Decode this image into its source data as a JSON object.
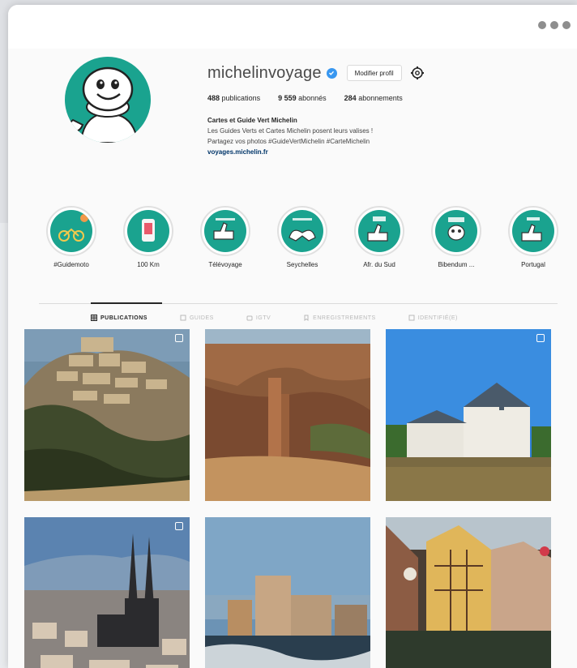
{
  "window": {
    "menu_icon": "ellipsis-icon"
  },
  "profile": {
    "username": "michelinvoyage",
    "edit_label": "Modifier profil",
    "stats": {
      "publications_count": "488",
      "publications_label": "publications",
      "followers_count": "9 559",
      "followers_label": "abonnés",
      "following_count": "284",
      "following_label": "abonnements"
    },
    "bio": {
      "name": "Cartes et Guide Vert Michelin",
      "line1": "Les Guides Verts et Cartes Michelin posent leurs valises !",
      "line2": "Partagez vos photos #GuideVertMichelin #CarteMichelin",
      "link": "voyages.michelin.fr"
    }
  },
  "highlights": [
    {
      "label": "#Guidemoto"
    },
    {
      "label": "100 Km"
    },
    {
      "label": "Télévoyage"
    },
    {
      "label": "Seychelles"
    },
    {
      "label": "Afr. du Sud"
    },
    {
      "label": "Bibendum ..."
    },
    {
      "label": "Portugal"
    }
  ],
  "tabs": [
    {
      "label": "PUBLICATIONS",
      "active": true
    },
    {
      "label": "GUIDES",
      "active": false
    },
    {
      "label": "IGTV",
      "active": false
    },
    {
      "label": "ENREGISTREMENTS",
      "active": false
    },
    {
      "label": "IDENTIFIÉ(E)",
      "active": false
    }
  ],
  "posts": [
    {
      "subject": "hilltop village (Gordes)",
      "multi": true
    },
    {
      "subject": "canyon rock spire",
      "multi": false
    },
    {
      "subject": "Château de Chenonceau",
      "multi": true
    },
    {
      "subject": "cathedral city panorama",
      "multi": true
    },
    {
      "subject": "seaside fortress",
      "multi": false
    },
    {
      "subject": "half-timbered houses by canal",
      "multi": false
    }
  ],
  "colors": {
    "michelin_green": "#1aa38f",
    "verified_blue": "#3897f0",
    "link_blue": "#003569"
  }
}
